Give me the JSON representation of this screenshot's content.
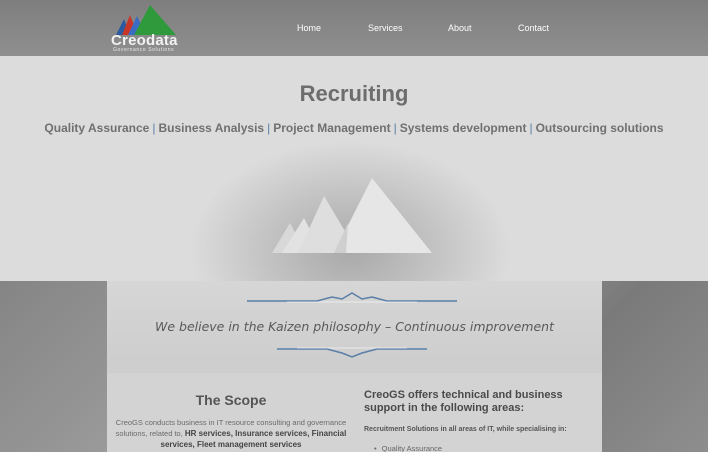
{
  "header": {
    "logo_text": "Creodata",
    "logo_subtitle": "Governance Solutions",
    "nav": [
      {
        "label": "Home"
      },
      {
        "label": "Services"
      },
      {
        "label": "About"
      },
      {
        "label": "Contact"
      }
    ]
  },
  "hero": {
    "title": "Recruiting",
    "tags": [
      "Quality Assurance",
      "Business Analysis",
      "Project Management",
      "Systems development",
      "Outsourcing solutions"
    ],
    "separator": "|"
  },
  "motto": "We believe in the Kaizen philosophy – Continuous improvement",
  "scope": {
    "title": "The Scope",
    "text_intro": "CreoGS conducts business in IT resource consulting and governance solutions, related to,",
    "text_bold": "HR services, Insurance services, Financial services, Fleet management services"
  },
  "areas": {
    "title": "CreoGS offers technical and business support in the following areas:",
    "subtitle": "Recruitment Solutions in all areas of IT, while specialising in:",
    "items": [
      "Quality Assurance"
    ]
  },
  "colors": {
    "separator_blue": "#5a7ea8",
    "logo_green": "#2e9a3c",
    "logo_red": "#c8362a",
    "logo_blue": "#2c5aa0"
  }
}
